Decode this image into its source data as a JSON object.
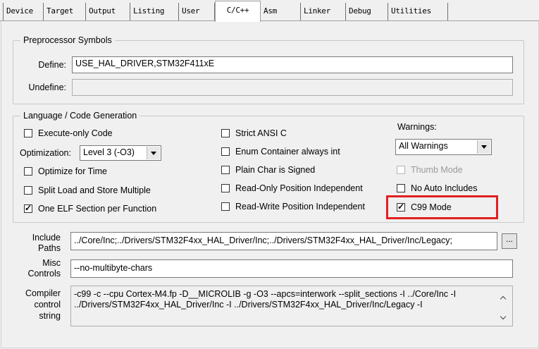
{
  "tabs": [
    "Device",
    "Target",
    "Output",
    "Listing",
    "User",
    "C/C++",
    "Asm",
    "Linker",
    "Debug",
    "Utilities"
  ],
  "active_tab": "C/C++",
  "preprocessor": {
    "legend": "Preprocessor Symbols",
    "define_label": "Define:",
    "define_value": "USE_HAL_DRIVER,STM32F411xE",
    "undefine_label": "Undefine:",
    "undefine_value": ""
  },
  "language": {
    "legend": "Language / Code Generation",
    "execute_only": {
      "label": "Execute-only Code",
      "checked": false
    },
    "optimization_label": "Optimization:",
    "optimization_value": "Level 3 (-O3)",
    "optimize_time": {
      "label": "Optimize for Time",
      "checked": false
    },
    "split_load": {
      "label": "Split Load and Store Multiple",
      "checked": false
    },
    "one_elf": {
      "label": "One ELF Section per Function",
      "checked": true
    },
    "strict_ansi": {
      "label": "Strict ANSI C",
      "checked": false
    },
    "enum_container": {
      "label": "Enum Container always int",
      "checked": false
    },
    "plain_char": {
      "label": "Plain Char is Signed",
      "checked": false
    },
    "ro_pos_indep": {
      "label": "Read-Only Position Independent",
      "checked": false
    },
    "rw_pos_indep": {
      "label": "Read-Write Position Independent",
      "checked": false
    },
    "warnings_label": "Warnings:",
    "warnings_value": "All Warnings",
    "thumb_mode": {
      "label": "Thumb Mode",
      "checked": false,
      "disabled": true
    },
    "no_auto_includes": {
      "label": "No Auto Includes",
      "checked": false
    },
    "c99_mode": {
      "label": "C99 Mode",
      "checked": true
    }
  },
  "include_paths": {
    "label_line1": "Include",
    "label_line2": "Paths",
    "value": "../Core/Inc;../Drivers/STM32F4xx_HAL_Driver/Inc;../Drivers/STM32F4xx_HAL_Driver/Inc/Legacy;",
    "browse": "..."
  },
  "misc_controls": {
    "label_line1": "Misc",
    "label_line2": "Controls",
    "value": "--no-multibyte-chars"
  },
  "compiler_control": {
    "label_line1": "Compiler",
    "label_line2": "control",
    "label_line3": "string",
    "line1": "-c99 -c --cpu Cortex-M4.fp -D__MICROLIB -g -O3 --apcs=interwork --split_sections -I ../Core/Inc -I",
    "line2": "../Drivers/STM32F4xx_HAL_Driver/Inc -I ../Drivers/STM32F4xx_HAL_Driver/Inc/Legacy -I"
  },
  "colors": {
    "highlight": "#e02020",
    "panel_bg": "#f0f0f0"
  }
}
